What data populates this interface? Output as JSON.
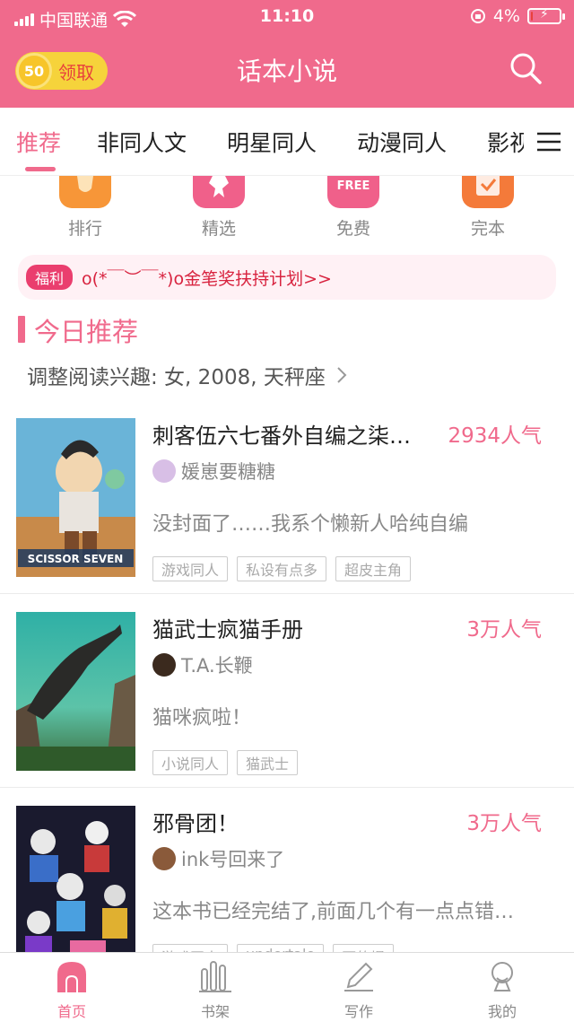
{
  "status_bar": {
    "carrier": "中国联通",
    "time": "11:10",
    "battery": "4%",
    "battery_level": 0.04
  },
  "header": {
    "coin_count": "50",
    "coin_label": "领取",
    "title": "话本小说"
  },
  "tabs": [
    "推荐",
    "非同人文",
    "明星同人",
    "动漫同人",
    "影视"
  ],
  "entries": [
    {
      "label": "排行",
      "icon": "trophy-icon",
      "color": "#f79638"
    },
    {
      "label": "精选",
      "icon": "star-icon",
      "color": "#f0608a"
    },
    {
      "label": "免费",
      "icon": "free-icon",
      "color": "#f0608a",
      "icon_text": "FREE"
    },
    {
      "label": "完本",
      "icon": "check-icon",
      "color": "#f47a3a"
    }
  ],
  "notice": {
    "badge": "福利",
    "text": "o(*￣︶￣*)o金笔奖扶持计划>>"
  },
  "section": {
    "title": "今日推荐",
    "prefs": "调整阅读兴趣: 女, 2008, 天秤座"
  },
  "books": [
    {
      "title": "刺客伍六七番外自编之柒…",
      "popularity": "2934人气",
      "author": "媛崽要糖糖",
      "desc": "没封面了……我系个懒新人哈纯自编",
      "tags": [
        "游戏同人",
        "私设有点多",
        "超皮主角"
      ],
      "cover_text": "SCISSOR SEVEN"
    },
    {
      "title": "猫武士疯猫手册",
      "popularity": "3万人气",
      "author": "T.A.长鞭",
      "desc": "猫咪疯啦！",
      "tags": [
        "小说同人",
        "猫武士"
      ]
    },
    {
      "title": "邪骨团！",
      "popularity": "3万人气",
      "author": "ink号回来了",
      "desc": "这本书已经完结了,前面几个有一点点错…",
      "tags": [
        "游戏同人",
        "undertale",
        "更的慢"
      ]
    }
  ],
  "bottom_nav": [
    "首页",
    "书架",
    "写作",
    "我的"
  ],
  "colors": {
    "brand": "#f06a8c",
    "coin": "#f6d33b",
    "notice_text": "#d8233f"
  }
}
